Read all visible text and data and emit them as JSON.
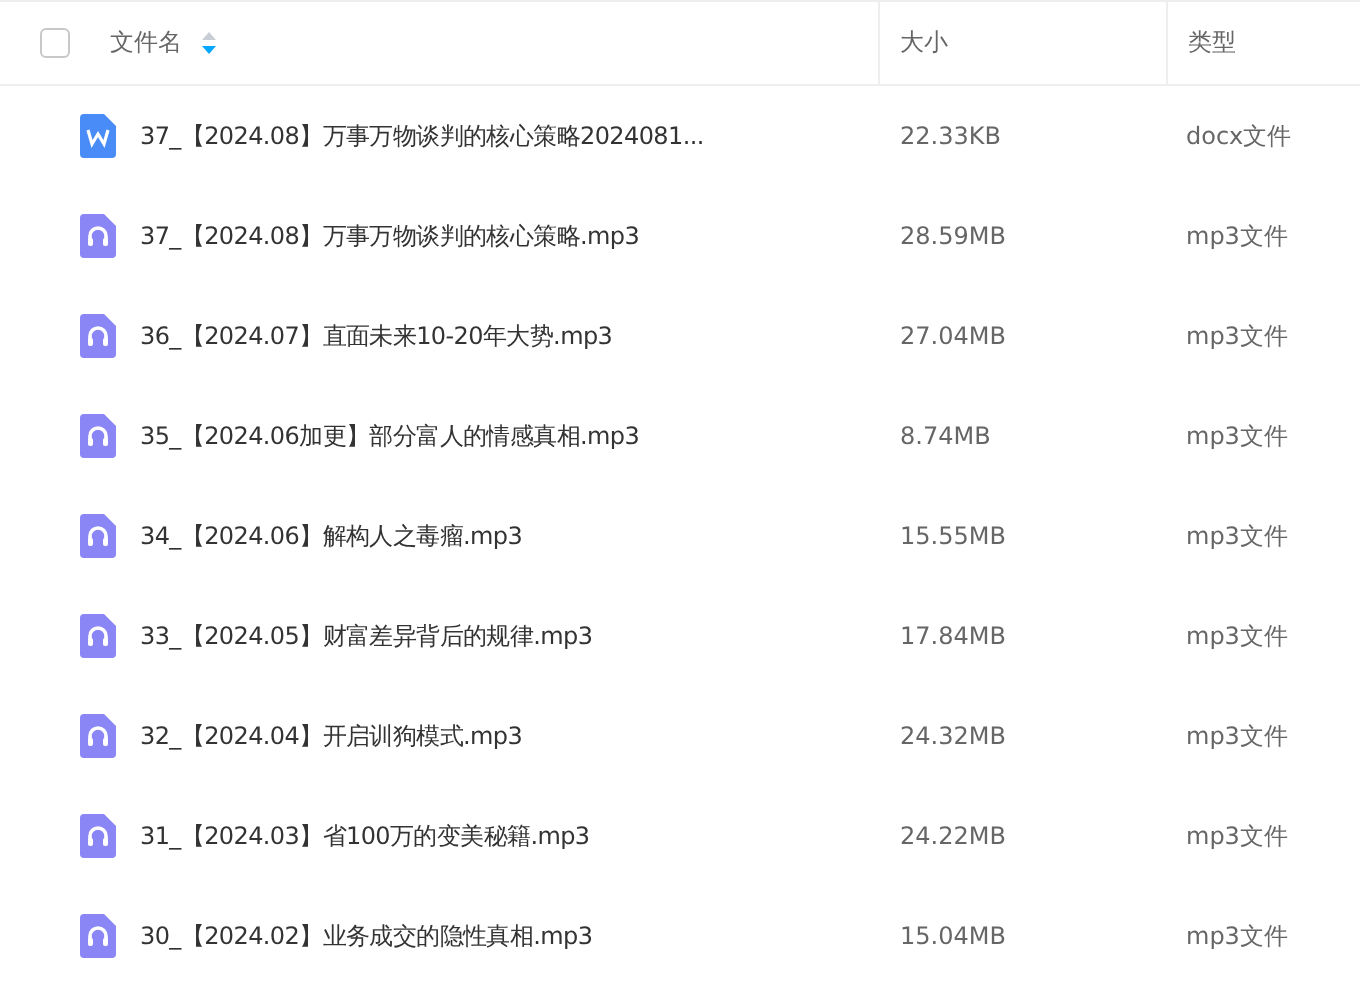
{
  "header": {
    "checked": false,
    "columns": [
      {
        "label": "文件名",
        "sorted": true
      },
      {
        "label": "大小",
        "sorted": false
      },
      {
        "label": "类型",
        "sorted": false
      }
    ]
  },
  "rows": [
    {
      "kind": "docx",
      "name": "37_【2024.08】万事万物谈判的核心策略2024081...",
      "size": "22.33KB",
      "type": "docx文件"
    },
    {
      "kind": "audio",
      "name": "37_【2024.08】万事万物谈判的核心策略.mp3",
      "size": "28.59MB",
      "type": "mp3文件"
    },
    {
      "kind": "audio",
      "name": "36_【2024.07】直面未来10-20年大势.mp3",
      "size": "27.04MB",
      "type": "mp3文件"
    },
    {
      "kind": "audio",
      "name": "35_【2024.06加更】部分富人的情感真相.mp3",
      "size": "8.74MB",
      "type": "mp3文件"
    },
    {
      "kind": "audio",
      "name": "34_【2024.06】解构人之毒瘤.mp3",
      "size": "15.55MB",
      "type": "mp3文件"
    },
    {
      "kind": "audio",
      "name": "33_【2024.05】财富差异背后的规律.mp3",
      "size": "17.84MB",
      "type": "mp3文件"
    },
    {
      "kind": "audio",
      "name": "32_【2024.04】开启训狗模式.mp3",
      "size": "24.32MB",
      "type": "mp3文件"
    },
    {
      "kind": "audio",
      "name": "31_【2024.03】省100万的变美秘籍.mp3",
      "size": "24.22MB",
      "type": "mp3文件"
    },
    {
      "kind": "audio",
      "name": "30_【2024.02】业务成交的隐性真相.mp3",
      "size": "15.04MB",
      "type": "mp3文件"
    }
  ]
}
